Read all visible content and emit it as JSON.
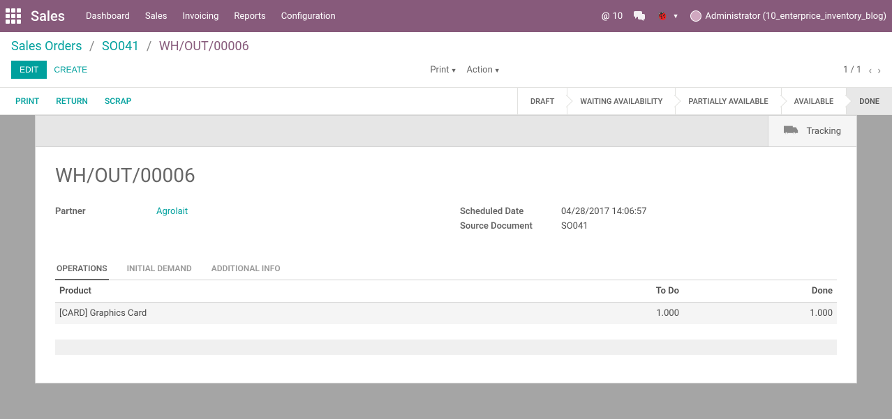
{
  "nav": {
    "brand": "Sales",
    "items": [
      "Dashboard",
      "Sales",
      "Invoicing",
      "Reports",
      "Configuration"
    ],
    "msg_count": "10",
    "user": "Administrator (10_enterprice_inventory_blog)"
  },
  "breadcrumb": {
    "root": "Sales Orders",
    "parent": "SO041",
    "current": "WH/OUT/00006"
  },
  "cp": {
    "edit": "EDIT",
    "create": "CREATE",
    "print": "Print",
    "action": "Action",
    "pager": "1 / 1"
  },
  "actions": {
    "print": "PRINT",
    "return": "RETURN",
    "scrap": "SCRAP"
  },
  "status": [
    "DRAFT",
    "WAITING AVAILABILITY",
    "PARTIALLY AVAILABLE",
    "AVAILABLE",
    "DONE"
  ],
  "tracking_label": "Tracking",
  "record": {
    "title": "WH/OUT/00006",
    "partner_label": "Partner",
    "partner": "Agrolait",
    "scheduled_label": "Scheduled Date",
    "scheduled": "04/28/2017 14:06:57",
    "source_label": "Source Document",
    "source": "SO041"
  },
  "tabs": [
    "OPERATIONS",
    "INITIAL DEMAND",
    "ADDITIONAL INFO"
  ],
  "table": {
    "headers": {
      "product": "Product",
      "todo": "To Do",
      "done": "Done"
    },
    "rows": [
      {
        "product": "[CARD] Graphics Card",
        "todo": "1.000",
        "done": "1.000"
      }
    ]
  }
}
